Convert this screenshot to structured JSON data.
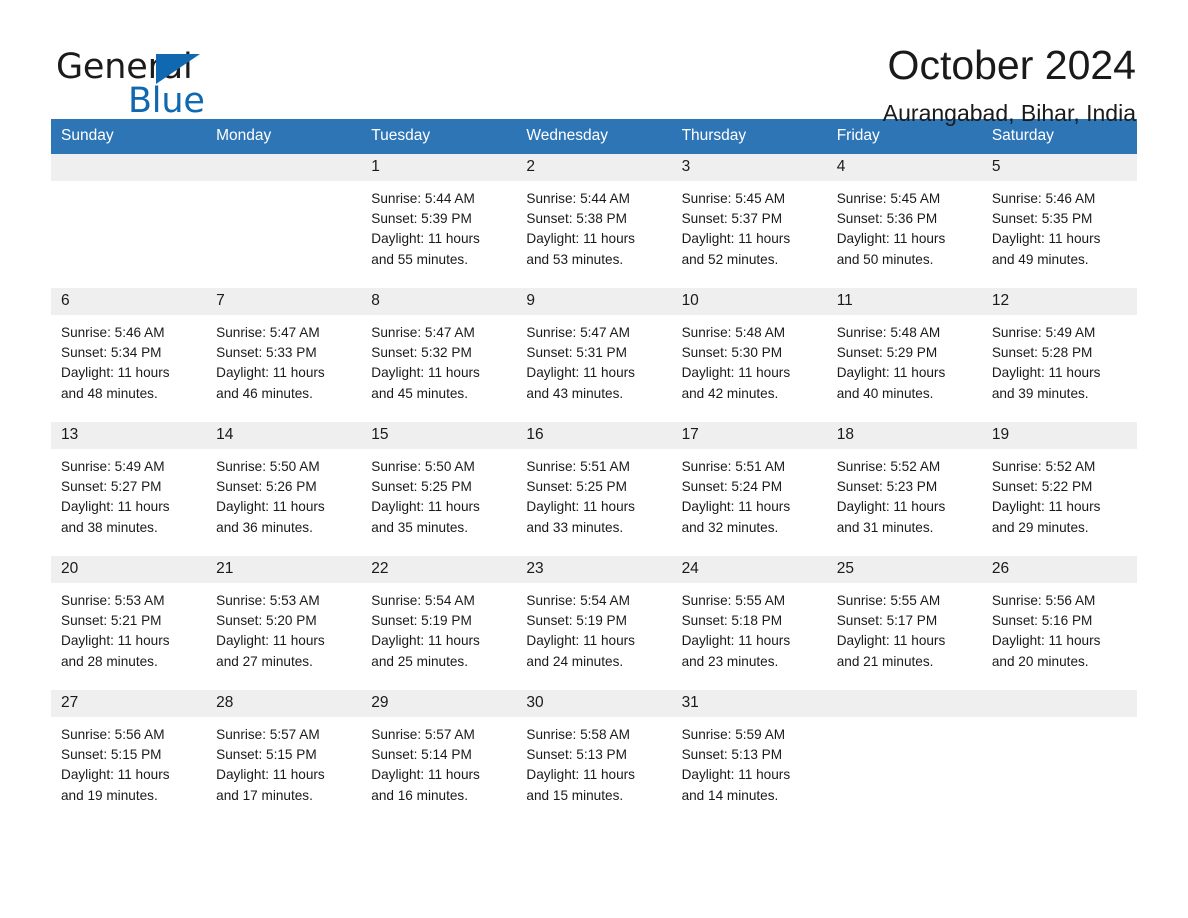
{
  "brand": {
    "name_part1": "General",
    "name_part2": "Blue",
    "triangle_color": "#1068b0",
    "text_color": "#1b1b1b"
  },
  "header": {
    "title": "October 2024",
    "location": "Aurangabad, Bihar, India",
    "accent_color": "#2e75b6",
    "daynum_band_color": "#efefef"
  },
  "weekday_headers": [
    "Sunday",
    "Monday",
    "Tuesday",
    "Wednesday",
    "Thursday",
    "Friday",
    "Saturday"
  ],
  "weeks": [
    [
      {
        "day": "",
        "lines": []
      },
      {
        "day": "",
        "lines": []
      },
      {
        "day": "1",
        "lines": [
          "Sunrise: 5:44 AM",
          "Sunset: 5:39 PM",
          "Daylight: 11 hours",
          "and 55 minutes."
        ]
      },
      {
        "day": "2",
        "lines": [
          "Sunrise: 5:44 AM",
          "Sunset: 5:38 PM",
          "Daylight: 11 hours",
          "and 53 minutes."
        ]
      },
      {
        "day": "3",
        "lines": [
          "Sunrise: 5:45 AM",
          "Sunset: 5:37 PM",
          "Daylight: 11 hours",
          "and 52 minutes."
        ]
      },
      {
        "day": "4",
        "lines": [
          "Sunrise: 5:45 AM",
          "Sunset: 5:36 PM",
          "Daylight: 11 hours",
          "and 50 minutes."
        ]
      },
      {
        "day": "5",
        "lines": [
          "Sunrise: 5:46 AM",
          "Sunset: 5:35 PM",
          "Daylight: 11 hours",
          "and 49 minutes."
        ]
      }
    ],
    [
      {
        "day": "6",
        "lines": [
          "Sunrise: 5:46 AM",
          "Sunset: 5:34 PM",
          "Daylight: 11 hours",
          "and 48 minutes."
        ]
      },
      {
        "day": "7",
        "lines": [
          "Sunrise: 5:47 AM",
          "Sunset: 5:33 PM",
          "Daylight: 11 hours",
          "and 46 minutes."
        ]
      },
      {
        "day": "8",
        "lines": [
          "Sunrise: 5:47 AM",
          "Sunset: 5:32 PM",
          "Daylight: 11 hours",
          "and 45 minutes."
        ]
      },
      {
        "day": "9",
        "lines": [
          "Sunrise: 5:47 AM",
          "Sunset: 5:31 PM",
          "Daylight: 11 hours",
          "and 43 minutes."
        ]
      },
      {
        "day": "10",
        "lines": [
          "Sunrise: 5:48 AM",
          "Sunset: 5:30 PM",
          "Daylight: 11 hours",
          "and 42 minutes."
        ]
      },
      {
        "day": "11",
        "lines": [
          "Sunrise: 5:48 AM",
          "Sunset: 5:29 PM",
          "Daylight: 11 hours",
          "and 40 minutes."
        ]
      },
      {
        "day": "12",
        "lines": [
          "Sunrise: 5:49 AM",
          "Sunset: 5:28 PM",
          "Daylight: 11 hours",
          "and 39 minutes."
        ]
      }
    ],
    [
      {
        "day": "13",
        "lines": [
          "Sunrise: 5:49 AM",
          "Sunset: 5:27 PM",
          "Daylight: 11 hours",
          "and 38 minutes."
        ]
      },
      {
        "day": "14",
        "lines": [
          "Sunrise: 5:50 AM",
          "Sunset: 5:26 PM",
          "Daylight: 11 hours",
          "and 36 minutes."
        ]
      },
      {
        "day": "15",
        "lines": [
          "Sunrise: 5:50 AM",
          "Sunset: 5:25 PM",
          "Daylight: 11 hours",
          "and 35 minutes."
        ]
      },
      {
        "day": "16",
        "lines": [
          "Sunrise: 5:51 AM",
          "Sunset: 5:25 PM",
          "Daylight: 11 hours",
          "and 33 minutes."
        ]
      },
      {
        "day": "17",
        "lines": [
          "Sunrise: 5:51 AM",
          "Sunset: 5:24 PM",
          "Daylight: 11 hours",
          "and 32 minutes."
        ]
      },
      {
        "day": "18",
        "lines": [
          "Sunrise: 5:52 AM",
          "Sunset: 5:23 PM",
          "Daylight: 11 hours",
          "and 31 minutes."
        ]
      },
      {
        "day": "19",
        "lines": [
          "Sunrise: 5:52 AM",
          "Sunset: 5:22 PM",
          "Daylight: 11 hours",
          "and 29 minutes."
        ]
      }
    ],
    [
      {
        "day": "20",
        "lines": [
          "Sunrise: 5:53 AM",
          "Sunset: 5:21 PM",
          "Daylight: 11 hours",
          "and 28 minutes."
        ]
      },
      {
        "day": "21",
        "lines": [
          "Sunrise: 5:53 AM",
          "Sunset: 5:20 PM",
          "Daylight: 11 hours",
          "and 27 minutes."
        ]
      },
      {
        "day": "22",
        "lines": [
          "Sunrise: 5:54 AM",
          "Sunset: 5:19 PM",
          "Daylight: 11 hours",
          "and 25 minutes."
        ]
      },
      {
        "day": "23",
        "lines": [
          "Sunrise: 5:54 AM",
          "Sunset: 5:19 PM",
          "Daylight: 11 hours",
          "and 24 minutes."
        ]
      },
      {
        "day": "24",
        "lines": [
          "Sunrise: 5:55 AM",
          "Sunset: 5:18 PM",
          "Daylight: 11 hours",
          "and 23 minutes."
        ]
      },
      {
        "day": "25",
        "lines": [
          "Sunrise: 5:55 AM",
          "Sunset: 5:17 PM",
          "Daylight: 11 hours",
          "and 21 minutes."
        ]
      },
      {
        "day": "26",
        "lines": [
          "Sunrise: 5:56 AM",
          "Sunset: 5:16 PM",
          "Daylight: 11 hours",
          "and 20 minutes."
        ]
      }
    ],
    [
      {
        "day": "27",
        "lines": [
          "Sunrise: 5:56 AM",
          "Sunset: 5:15 PM",
          "Daylight: 11 hours",
          "and 19 minutes."
        ]
      },
      {
        "day": "28",
        "lines": [
          "Sunrise: 5:57 AM",
          "Sunset: 5:15 PM",
          "Daylight: 11 hours",
          "and 17 minutes."
        ]
      },
      {
        "day": "29",
        "lines": [
          "Sunrise: 5:57 AM",
          "Sunset: 5:14 PM",
          "Daylight: 11 hours",
          "and 16 minutes."
        ]
      },
      {
        "day": "30",
        "lines": [
          "Sunrise: 5:58 AM",
          "Sunset: 5:13 PM",
          "Daylight: 11 hours",
          "and 15 minutes."
        ]
      },
      {
        "day": "31",
        "lines": [
          "Sunrise: 5:59 AM",
          "Sunset: 5:13 PM",
          "Daylight: 11 hours",
          "and 14 minutes."
        ]
      },
      {
        "day": "",
        "lines": []
      },
      {
        "day": "",
        "lines": []
      }
    ]
  ]
}
